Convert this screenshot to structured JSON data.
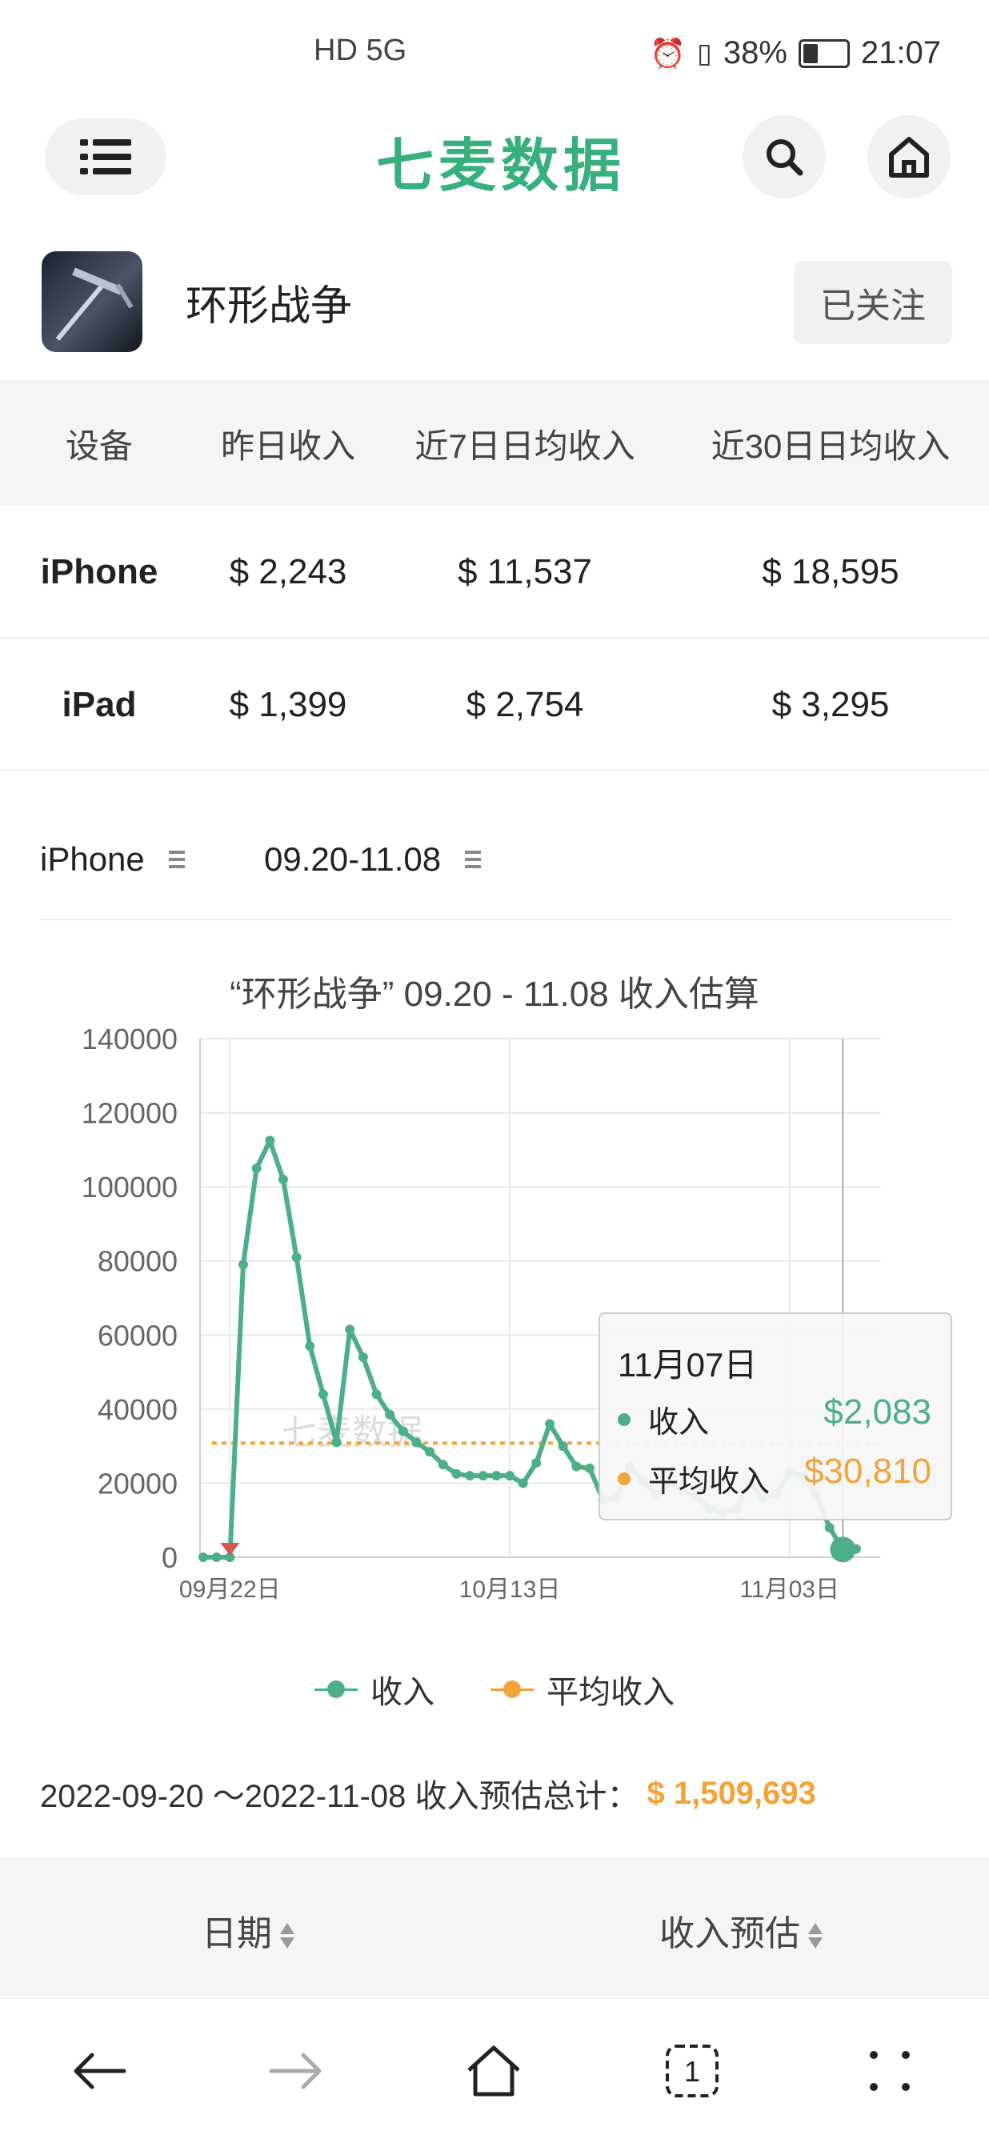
{
  "status_bar": {
    "network": "HD 5G",
    "battery": "38%",
    "time": "21:07"
  },
  "header": {
    "logo": "七麦数据"
  },
  "app": {
    "name": "环形战争",
    "follow_label": "已关注"
  },
  "summary": {
    "headers": [
      "设备",
      "昨日收入",
      "近7日日均收入",
      "近30日日均收入"
    ],
    "rows": [
      {
        "device": "iPhone",
        "yesterday": "$ 2,243",
        "avg7": "$ 11,537",
        "avg30": "$ 18,595"
      },
      {
        "device": "iPad",
        "yesterday": "$ 1,399",
        "avg7": "$ 2,754",
        "avg30": "$ 3,295"
      }
    ]
  },
  "filters": {
    "device": "iPhone",
    "date_range": "09.20-11.08"
  },
  "chart": {
    "title": "“环形战争”  09.20 - 11.08 收入估算",
    "watermark": "七麦数据",
    "tooltip": {
      "date": "11月07日",
      "revenue_label": "收入",
      "revenue_value": "$2,083",
      "avg_label": "平均收入",
      "avg_value": "$30,810"
    },
    "legend": [
      "收入",
      "平均收入"
    ]
  },
  "chart_data": {
    "type": "line",
    "title": "“环形战争”  09.20 - 11.08 收入估算",
    "x_tick_labels": [
      "09月22日",
      "10月13日",
      "11月03日"
    ],
    "y_ticks": [
      0,
      20000,
      40000,
      60000,
      80000,
      100000,
      120000,
      140000
    ],
    "ylim": [
      0,
      140000
    ],
    "grid": true,
    "legend_position": "bottom",
    "series": [
      {
        "name": "收入",
        "color": "#4caf87",
        "values": [
          0,
          0,
          0,
          79000,
          105000,
          112500,
          102000,
          81000,
          57000,
          44000,
          31000,
          61500,
          54000,
          44000,
          38500,
          34000,
          31000,
          28500,
          25000,
          22500,
          22000,
          22000,
          22000,
          22000,
          20000,
          25500,
          36000,
          30000,
          24500,
          24000,
          15500,
          16000,
          24500,
          20500,
          17000,
          20000,
          18000,
          16500,
          13000,
          12000,
          13000,
          20000,
          16000,
          17000,
          23000,
          22000,
          17000,
          8000,
          2083,
          2243
        ]
      },
      {
        "name": "平均收入",
        "color": "#f2a33a",
        "values": [
          30810
        ]
      }
    ],
    "x_start": "2022-09-20",
    "x_end": "2022-11-08"
  },
  "total": {
    "range": "2022-09-20 ～2022-11-08 收入预估总计：",
    "amount": "$ 1,509,693"
  },
  "detail_table": {
    "headers": [
      "日期",
      "收入预估"
    ]
  }
}
